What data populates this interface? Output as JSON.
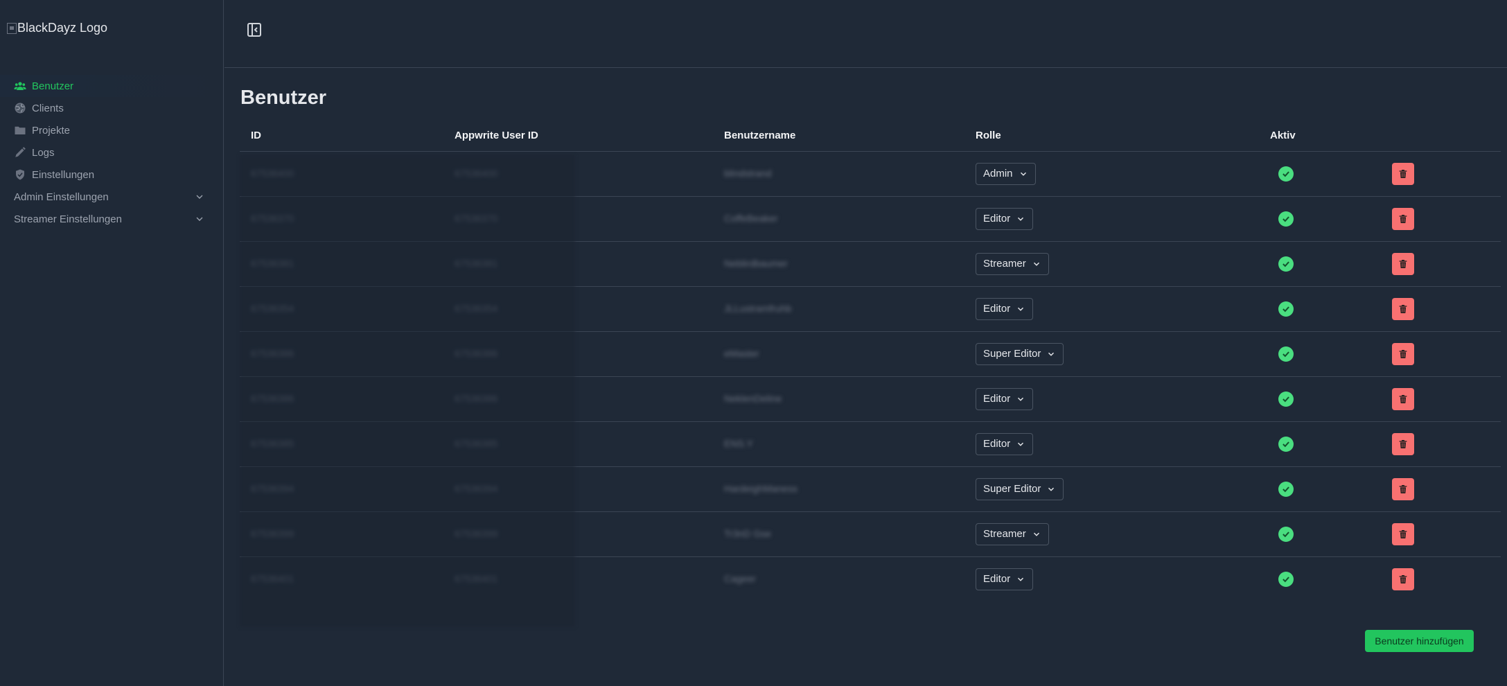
{
  "sidebar": {
    "logo_alt": "BlackDayz Logo",
    "items": [
      {
        "label": "Benutzer",
        "icon": "users-icon",
        "active": true
      },
      {
        "label": "Clients",
        "icon": "globe-icon",
        "active": false
      },
      {
        "label": "Projekte",
        "icon": "folder-icon",
        "active": false
      },
      {
        "label": "Logs",
        "icon": "pencil-icon",
        "active": false
      },
      {
        "label": "Einstellungen",
        "icon": "shield-check-icon",
        "active": false
      }
    ],
    "groups": [
      {
        "label": "Admin Einstellungen"
      },
      {
        "label": "Streamer Einstellungen"
      }
    ]
  },
  "main": {
    "title": "Benutzer",
    "columns": [
      "ID",
      "Appwrite User ID",
      "Benutzername",
      "Rolle",
      "Aktiv"
    ],
    "rows": [
      {
        "id": "67536400",
        "appwrite_id": "67536400",
        "username": "blindstrand",
        "role": "Admin"
      },
      {
        "id": "67536370",
        "appwrite_id": "67536370",
        "username": "CoffeBeaker",
        "role": "Editor"
      },
      {
        "id": "67536381",
        "appwrite_id": "67536381",
        "username": "Neblirdbaumer",
        "role": "Streamer"
      },
      {
        "id": "67536354",
        "appwrite_id": "67536354",
        "username": "JLLustramfruhb",
        "role": "Editor"
      },
      {
        "id": "67536386",
        "appwrite_id": "67536386",
        "username": "eMaster",
        "role": "Super Editor"
      },
      {
        "id": "67536386",
        "appwrite_id": "67536386",
        "username": "NeklenDeline",
        "role": "Editor"
      },
      {
        "id": "67536385",
        "appwrite_id": "67536385",
        "username": "ENS.Y",
        "role": "Editor"
      },
      {
        "id": "67536394",
        "appwrite_id": "67536394",
        "username": "HardeighManess",
        "role": "Super Editor"
      },
      {
        "id": "67536399",
        "appwrite_id": "67536399",
        "username": "Tr3nD Gse",
        "role": "Streamer"
      },
      {
        "id": "67536401",
        "appwrite_id": "67536401",
        "username": "Cageer",
        "role": "Editor"
      }
    ],
    "add_user_label": "Benutzer hinzufügen"
  },
  "colors": {
    "accent": "#22c55e",
    "danger": "#f87171",
    "background": "#1f2937"
  }
}
